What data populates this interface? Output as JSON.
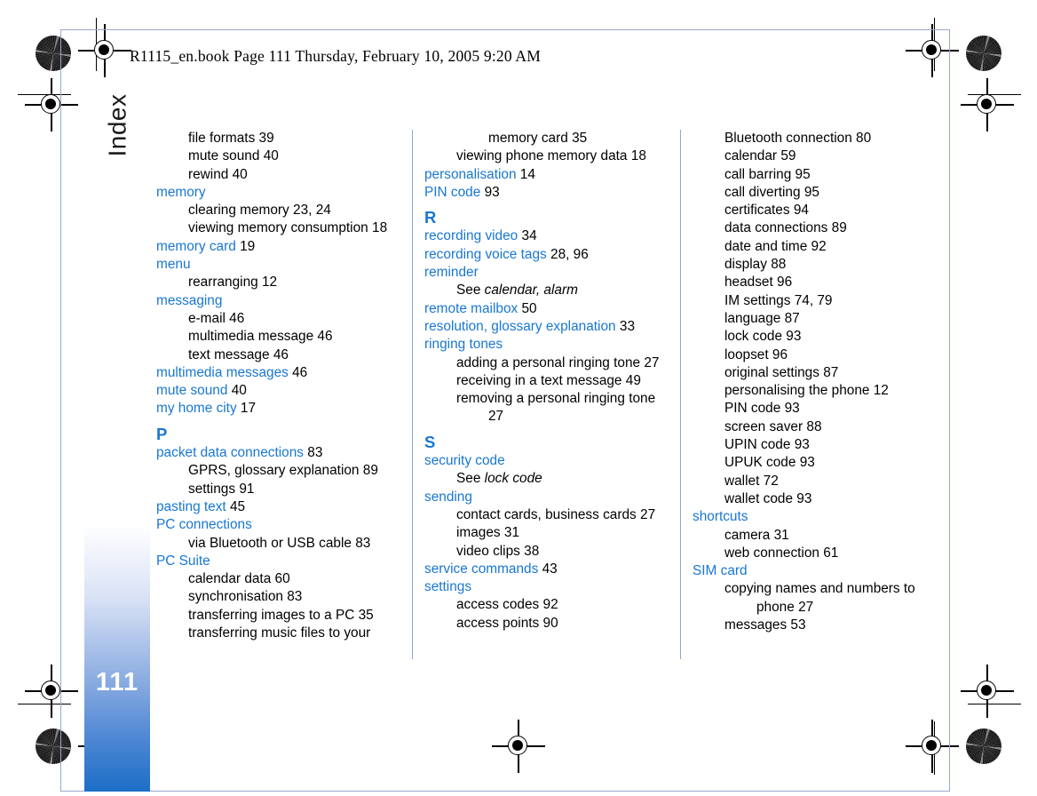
{
  "document": {
    "header_line": "R1115_en.book  Page 111  Thursday, February 10, 2005  9:20 AM",
    "side_tab_label": "Index",
    "page_number": "111",
    "accent_color": "#1877d2",
    "rule_color": "#8fa4d6",
    "tab_gradient_end": "#1c6ec6"
  },
  "columns": [
    {
      "name": "column-1",
      "entries": [
        {
          "level": 2,
          "text": "file formats",
          "pages": "39"
        },
        {
          "level": 2,
          "text": "mute sound",
          "pages": "40"
        },
        {
          "level": 2,
          "text": "rewind",
          "pages": "40"
        },
        {
          "level": 1,
          "text": "memory",
          "pages": ""
        },
        {
          "level": 2,
          "text": "clearing memory",
          "pages": "23, 24"
        },
        {
          "level": 2,
          "text": "viewing memory consumption",
          "pages": "18"
        },
        {
          "level": 1,
          "text": "memory card",
          "pages": "19"
        },
        {
          "level": 1,
          "text": "menu",
          "pages": ""
        },
        {
          "level": 2,
          "text": "rearranging",
          "pages": "12"
        },
        {
          "level": 1,
          "text": "messaging",
          "pages": ""
        },
        {
          "level": 2,
          "text": "e-mail",
          "pages": "46"
        },
        {
          "level": 2,
          "text": "multimedia message",
          "pages": "46"
        },
        {
          "level": 2,
          "text": "text message",
          "pages": "46"
        },
        {
          "level": 1,
          "text": "multimedia messages",
          "pages": "46"
        },
        {
          "level": 1,
          "text": "mute sound",
          "pages": "40"
        },
        {
          "level": 1,
          "text": "my home city",
          "pages": "17"
        },
        {
          "level": 0,
          "text": "P",
          "pages": ""
        },
        {
          "level": 1,
          "text": "packet data connections",
          "pages": "83"
        },
        {
          "level": 2,
          "text": "GPRS, glossary explanation",
          "pages": "89"
        },
        {
          "level": 2,
          "text": "settings",
          "pages": "91"
        },
        {
          "level": 1,
          "text": "pasting text",
          "pages": "45"
        },
        {
          "level": 1,
          "text": "PC connections",
          "pages": ""
        },
        {
          "level": 2,
          "text": "via Bluetooth or USB cable",
          "pages": "83"
        },
        {
          "level": 1,
          "text": "PC Suite",
          "pages": ""
        },
        {
          "level": 2,
          "text": "calendar data",
          "pages": "60"
        },
        {
          "level": 2,
          "text": "synchronisation",
          "pages": "83"
        },
        {
          "level": 2,
          "text": "transferring images to a PC",
          "pages": "35"
        },
        {
          "level": 2,
          "text": "transferring music files to your",
          "pages": ""
        }
      ]
    },
    {
      "name": "column-2",
      "entries": [
        {
          "level": 3,
          "text": "memory card",
          "pages": "35"
        },
        {
          "level": 2,
          "text": "viewing phone memory data",
          "pages": "18"
        },
        {
          "level": 1,
          "text": "personalisation",
          "pages": "14"
        },
        {
          "level": 1,
          "text": "PIN code",
          "pages": "93"
        },
        {
          "level": 0,
          "text": "R",
          "pages": ""
        },
        {
          "level": 1,
          "text": "recording video",
          "pages": "34"
        },
        {
          "level": 1,
          "text": "recording voice tags",
          "pages": "28, 96"
        },
        {
          "level": 1,
          "text": "reminder",
          "pages": ""
        },
        {
          "level": 2,
          "text": "See ",
          "italic": "calendar, alarm",
          "pages": ""
        },
        {
          "level": 1,
          "text": "remote mailbox",
          "pages": "50"
        },
        {
          "level": 1,
          "text": "resolution, glossary explanation",
          "pages": "33"
        },
        {
          "level": 1,
          "text": "ringing tones",
          "pages": ""
        },
        {
          "level": 2,
          "text": "adding a personal ringing tone",
          "pages": "27"
        },
        {
          "level": 2,
          "text": "receiving in a text message",
          "pages": "49"
        },
        {
          "level": 4,
          "text": "removing a personal ringing tone",
          "pages": "27"
        },
        {
          "level": 0,
          "text": "S",
          "pages": ""
        },
        {
          "level": 1,
          "text": "security code",
          "pages": ""
        },
        {
          "level": 2,
          "text": "See ",
          "italic": "lock code",
          "pages": ""
        },
        {
          "level": 1,
          "text": "sending",
          "pages": ""
        },
        {
          "level": 2,
          "text": "contact cards, business cards",
          "pages": "27"
        },
        {
          "level": 2,
          "text": "images",
          "pages": "31"
        },
        {
          "level": 2,
          "text": "video clips",
          "pages": "38"
        },
        {
          "level": 1,
          "text": "service commands",
          "pages": "43"
        },
        {
          "level": 1,
          "text": "settings",
          "pages": ""
        },
        {
          "level": 2,
          "text": "access codes",
          "pages": "92"
        },
        {
          "level": 2,
          "text": "access points",
          "pages": "90"
        }
      ]
    },
    {
      "name": "column-3",
      "entries": [
        {
          "level": 2,
          "text": "Bluetooth connection",
          "pages": "80"
        },
        {
          "level": 2,
          "text": "calendar",
          "pages": "59"
        },
        {
          "level": 2,
          "text": "call barring",
          "pages": "95"
        },
        {
          "level": 2,
          "text": "call diverting",
          "pages": "95"
        },
        {
          "level": 2,
          "text": "certificates",
          "pages": "94"
        },
        {
          "level": 2,
          "text": "data connections",
          "pages": "89"
        },
        {
          "level": 2,
          "text": "date and time",
          "pages": "92"
        },
        {
          "level": 2,
          "text": "display",
          "pages": "88"
        },
        {
          "level": 2,
          "text": "headset",
          "pages": "96"
        },
        {
          "level": 2,
          "text": "IM settings",
          "pages": "74, 79"
        },
        {
          "level": 2,
          "text": "language",
          "pages": "87"
        },
        {
          "level": 2,
          "text": "lock code",
          "pages": "93"
        },
        {
          "level": 2,
          "text": "loopset",
          "pages": "96"
        },
        {
          "level": 2,
          "text": "original settings",
          "pages": "87"
        },
        {
          "level": 2,
          "text": "personalising the phone",
          "pages": "12"
        },
        {
          "level": 2,
          "text": "PIN code",
          "pages": "93"
        },
        {
          "level": 2,
          "text": "screen saver",
          "pages": "88"
        },
        {
          "level": 2,
          "text": "UPIN code",
          "pages": "93"
        },
        {
          "level": 2,
          "text": "UPUK code",
          "pages": "93"
        },
        {
          "level": 2,
          "text": "wallet",
          "pages": "72"
        },
        {
          "level": 2,
          "text": "wallet code",
          "pages": "93"
        },
        {
          "level": 1,
          "text": "shortcuts",
          "pages": ""
        },
        {
          "level": 2,
          "text": "camera",
          "pages": "31"
        },
        {
          "level": 2,
          "text": "web connection",
          "pages": "61"
        },
        {
          "level": 1,
          "text": "SIM card",
          "pages": ""
        },
        {
          "level": 4,
          "text": "copying names and numbers to phone",
          "pages": "27"
        },
        {
          "level": 2,
          "text": "messages",
          "pages": "53"
        }
      ]
    }
  ]
}
